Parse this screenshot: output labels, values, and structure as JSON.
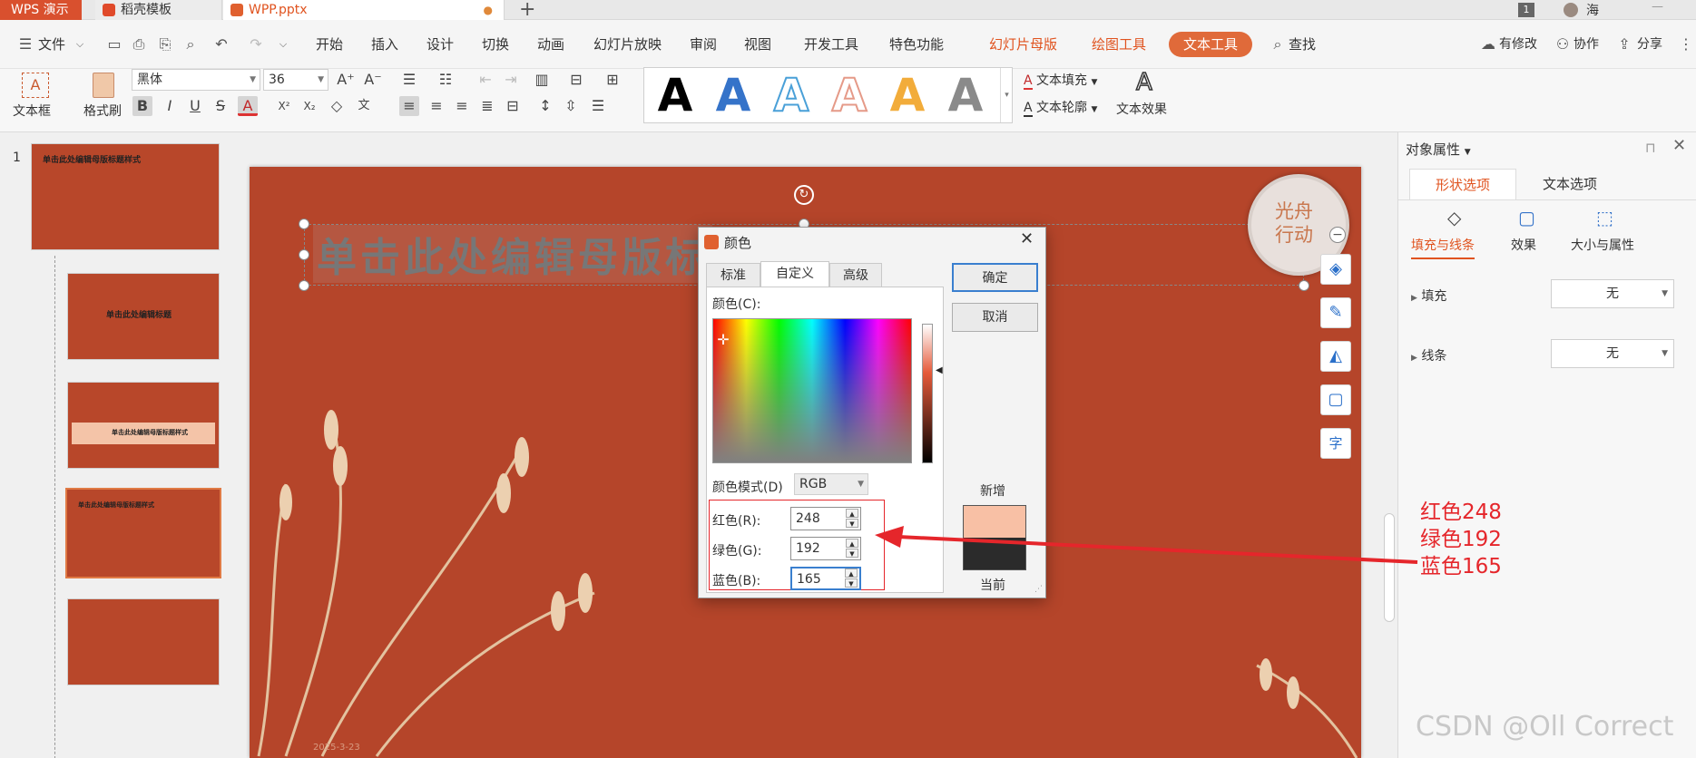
{
  "tabs": {
    "app": "WPS 演示",
    "template": "稻壳模板",
    "file": "WPP.pptx",
    "user_badge": "1",
    "user": "海"
  },
  "menu": {
    "file": "文件",
    "items": [
      "开始",
      "插入",
      "设计",
      "切换",
      "动画",
      "幻灯片放映",
      "审阅",
      "视图",
      "开发工具",
      "特色功能"
    ],
    "contextual": [
      "幻灯片母版",
      "绘图工具"
    ],
    "active_tool": "文本工具",
    "search": "查找",
    "right": [
      "有修改",
      "协作",
      "分享"
    ]
  },
  "ribbon": {
    "textbox": "文本框",
    "format_painter": "格式刷",
    "font": "黑体",
    "size": "36",
    "text_fill": "文本填充",
    "text_outline": "文本轮廓",
    "text_effect": "文本效果"
  },
  "slides": {
    "number": "1",
    "thumb_title": "单击此处编辑母版标题样式",
    "thumb2": "单击此处编辑标题",
    "thumb3": "单击此处编辑母版标题样式"
  },
  "slide": {
    "title": "单击此处编辑母版标",
    "badge_line1": "光舟",
    "badge_line2": "行动",
    "footer_date": "2025-3-23"
  },
  "pane": {
    "title": "对象属性",
    "tabs": [
      "形状选项",
      "文本选项"
    ],
    "subtabs": [
      "填充与线条",
      "效果",
      "大小与属性"
    ],
    "fill_label": "填充",
    "fill_value": "无",
    "line_label": "线条",
    "line_value": "无"
  },
  "dialog": {
    "title": "颜色",
    "tabs": [
      "标准",
      "自定义",
      "高级"
    ],
    "color_label": "颜色(C):",
    "mode_label": "颜色模式(D)",
    "mode_value": "RGB",
    "red_label": "红色(R):",
    "red": "248",
    "green_label": "绿色(G):",
    "green": "192",
    "blue_label": "蓝色(B):",
    "blue": "165",
    "ok": "确定",
    "cancel": "取消",
    "new_label": "新增",
    "current_label": "当前",
    "new_color": "#f8c0a5",
    "current_color": "#2b2b2b"
  },
  "annotation": {
    "line1": "红色248",
    "line2": "绿色192",
    "line3": "蓝色165"
  },
  "watermark": "CSDN @Oll Correct"
}
